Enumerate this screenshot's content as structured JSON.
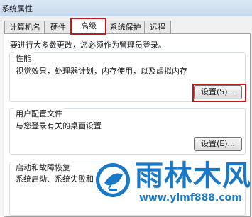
{
  "window": {
    "title": "系统属性"
  },
  "tabs": [
    {
      "label": "计算机名"
    },
    {
      "label": "硬件"
    },
    {
      "label": "高级",
      "active": true
    },
    {
      "label": "系统保护"
    },
    {
      "label": "远程"
    }
  ],
  "notice": "要进行大多数更改，您必须作为管理员登录。",
  "performance": {
    "label": "性能",
    "description": "视觉效果，处理器计划，内存使用，以及虚拟内存",
    "button": "设置(S)..."
  },
  "user_profiles": {
    "label": "用户配置文件",
    "description": "与您登录有关的桌面设置",
    "button": "设置(E)..."
  },
  "startup_recovery": {
    "label": "启动和故障恢复",
    "description": "系统启动、系统失败和"
  },
  "watermark": {
    "title": "雨林木风",
    "url": "www.ylmf888.com"
  },
  "colors": {
    "highlight_border": "#c0181c",
    "watermark_blue": "#1a79c7"
  }
}
